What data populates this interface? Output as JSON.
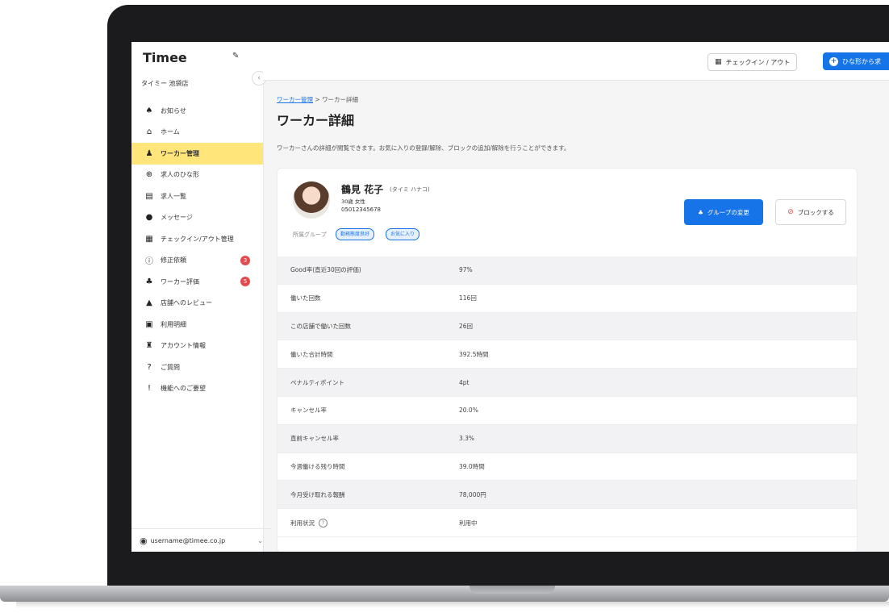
{
  "sidebar": {
    "logo": "Timee",
    "store": "タイミー 池袋店",
    "items": [
      {
        "label": "お知らせ",
        "icon": "bell-icon",
        "glyph": "♠"
      },
      {
        "label": "ホーム",
        "icon": "home-icon",
        "glyph": "⌂"
      },
      {
        "label": "ワーカー管理",
        "icon": "worker-icon",
        "glyph": "♟"
      },
      {
        "label": "求人のひな形",
        "icon": "plus-circle-icon",
        "glyph": "⊕"
      },
      {
        "label": "求人一覧",
        "icon": "list-icon",
        "glyph": "▤"
      },
      {
        "label": "メッセージ",
        "icon": "message-icon",
        "glyph": "●"
      },
      {
        "label": "チェックイン/アウト管理",
        "icon": "qr-icon",
        "glyph": "▦"
      },
      {
        "label": "修正依頼",
        "icon": "info-icon",
        "glyph": "ⓘ",
        "badge": "3"
      },
      {
        "label": "ワーカー評価",
        "icon": "rating-icon",
        "glyph": "♣",
        "badge": "5"
      },
      {
        "label": "店舗へのレビュー",
        "icon": "thumbs-up-icon",
        "glyph": "▲"
      },
      {
        "label": "利用明細",
        "icon": "document-icon",
        "glyph": "▣"
      },
      {
        "label": "アカウント情報",
        "icon": "account-icon",
        "glyph": "♜"
      },
      {
        "label": "ご質問",
        "icon": "question-icon",
        "glyph": "?"
      },
      {
        "label": "機能へのご要望",
        "icon": "alert-icon",
        "glyph": "!"
      }
    ],
    "user_email": "username@timee.co.jp"
  },
  "topbar": {
    "checkin_label": "チェックイン / アウト",
    "template_label": "ひな形から求"
  },
  "main": {
    "breadcrumb_link": "ワーカー管理",
    "breadcrumb_sep": " > ",
    "breadcrumb_current": "ワーカー詳細",
    "title": "ワーカー詳細",
    "description": "ワーカーさんの詳細が閲覧できます。お気に入りの登録/解除、ブロックの追加/解除を行うことができます。"
  },
  "worker": {
    "name": "鶴見 花子",
    "kana": "(タイミ ハナコ)",
    "age_gender": "30歳 女性",
    "phone": "05012345678",
    "group_label": "所属グループ",
    "tags": [
      "勤務態度良好",
      "お気に入り"
    ],
    "group_button": "グループの変更",
    "block_button": "ブロックする"
  },
  "stats": [
    {
      "label": "Good率(直近30回の評価)",
      "value": "97%"
    },
    {
      "label": "働いた回数",
      "value": "116回"
    },
    {
      "label": "この店舗で働いた回数",
      "value": "26回"
    },
    {
      "label": "働いた合計時間",
      "value": "392.5時間"
    },
    {
      "label": "ペナルティポイント",
      "value": "4pt"
    },
    {
      "label": "キャンセル率",
      "value": "20.0%"
    },
    {
      "label": "直前キャンセル率",
      "value": "3.3%"
    },
    {
      "label": "今週働ける残り時間",
      "value": "39.0時間"
    },
    {
      "label": "今月受け取れる報酬",
      "value": "78,000円"
    },
    {
      "label": "利用状況",
      "value": "利用中"
    }
  ],
  "colors": {
    "accent": "#1674e8",
    "active_nav": "#ffe57a",
    "badge": "#e5484d"
  }
}
